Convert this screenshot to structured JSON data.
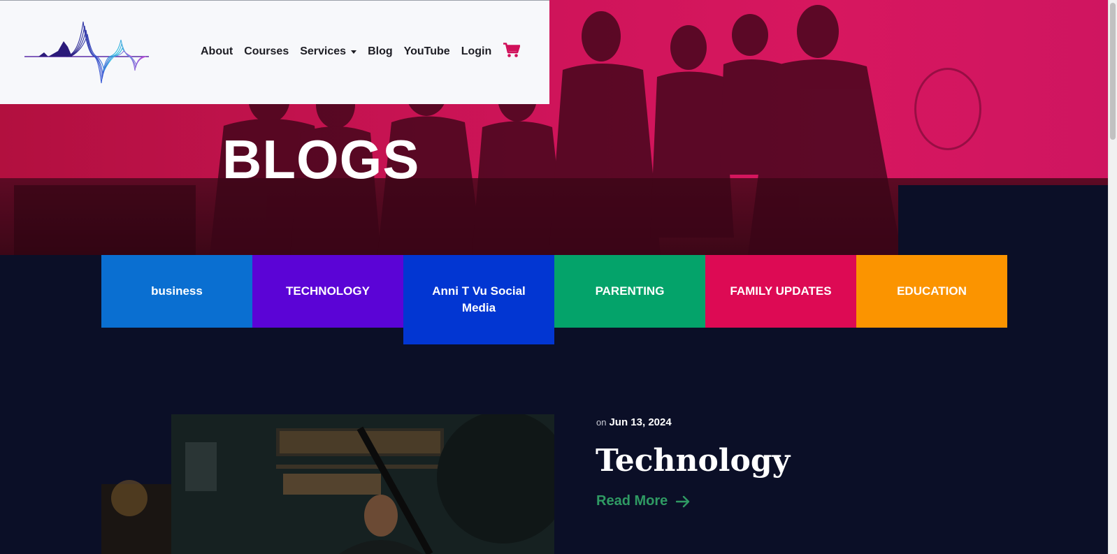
{
  "header": {
    "nav": [
      {
        "label": "About"
      },
      {
        "label": "Courses"
      },
      {
        "label": "Services",
        "has_dropdown": true
      },
      {
        "label": "Blog"
      },
      {
        "label": "YouTube"
      },
      {
        "label": "Login"
      }
    ],
    "cart_icon": "shopping-cart-icon",
    "cart_color": "#d0105a"
  },
  "hero": {
    "title": "BLOGS",
    "overlay_color": "#c4124f"
  },
  "categories": [
    {
      "label": "business",
      "color": "#0a6fd1"
    },
    {
      "label": "TECHNOLOGY",
      "color": "#5b04d6"
    },
    {
      "label": "Anni T Vu Social Media",
      "color": "#0236d2"
    },
    {
      "label": "PARENTING",
      "color": "#04a36a"
    },
    {
      "label": "FAMILY UPDATES",
      "color": "#dd0a54"
    },
    {
      "label": "EDUCATION",
      "color": "#fb9400"
    }
  ],
  "post": {
    "on_label": "on",
    "date": "Jun 13, 2024",
    "title": "Technology",
    "read_more": "Read More",
    "read_more_color": "#2f9a63"
  }
}
